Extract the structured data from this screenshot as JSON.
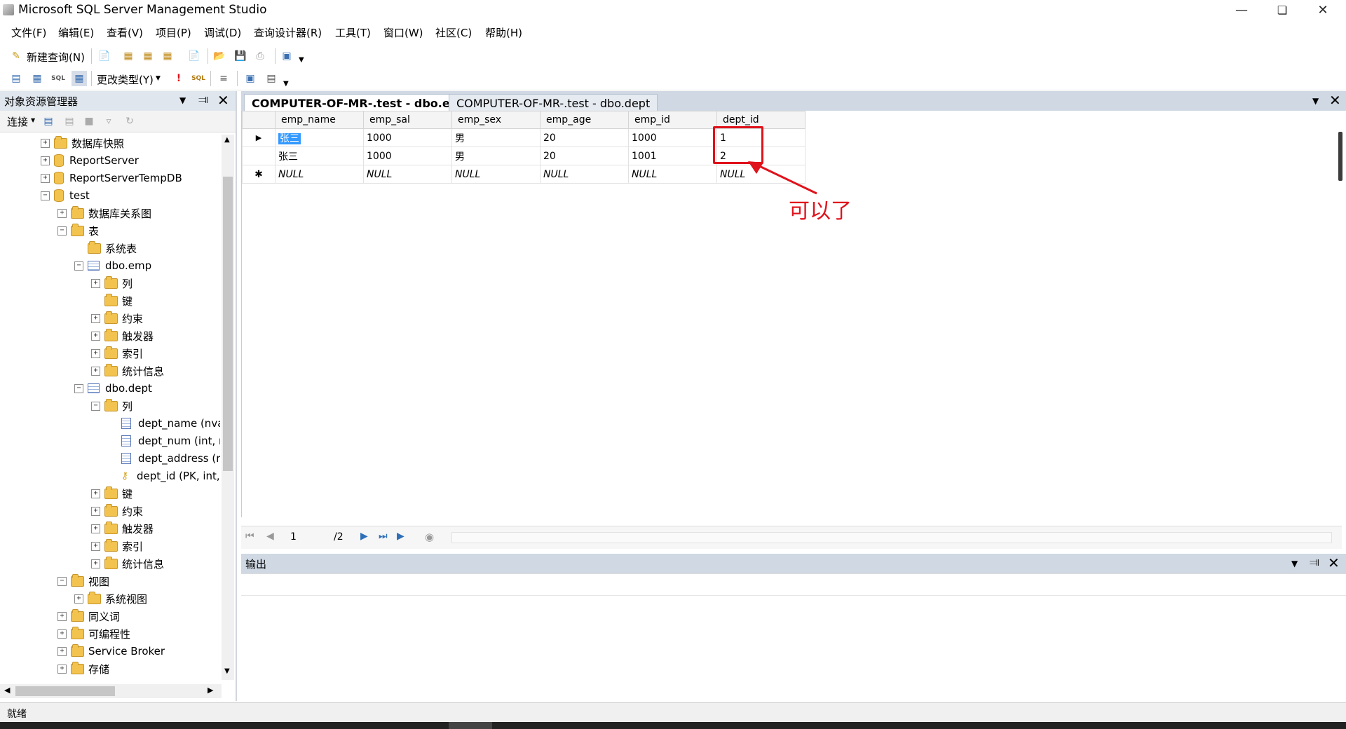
{
  "window": {
    "title": "Microsoft SQL Server Management Studio"
  },
  "menu": [
    "文件(F)",
    "编辑(E)",
    "查看(V)",
    "项目(P)",
    "调试(D)",
    "查询设计器(R)",
    "工具(T)",
    "窗口(W)",
    "社区(C)",
    "帮助(H)"
  ],
  "toolbar": {
    "new_query": "新建查询(N)",
    "change_type": "更改类型(Y)"
  },
  "object_explorer": {
    "title": "对象资源管理器",
    "connect": "连接",
    "tree": [
      {
        "label": "数据库快照",
        "level": 0,
        "expander": "+",
        "icon": "folder"
      },
      {
        "label": "ReportServer",
        "level": 0,
        "expander": "+",
        "icon": "db"
      },
      {
        "label": "ReportServerTempDB",
        "level": 0,
        "expander": "+",
        "icon": "db"
      },
      {
        "label": "test",
        "level": 0,
        "expander": "-",
        "icon": "db"
      },
      {
        "label": "数据库关系图",
        "level": 1,
        "expander": "+",
        "icon": "folder"
      },
      {
        "label": "表",
        "level": 1,
        "expander": "-",
        "icon": "folder"
      },
      {
        "label": "系统表",
        "level": 2,
        "expander": "",
        "icon": "folder"
      },
      {
        "label": "dbo.emp",
        "level": 2,
        "expander": "-",
        "icon": "table"
      },
      {
        "label": "列",
        "level": 3,
        "expander": "+",
        "icon": "folder"
      },
      {
        "label": "键",
        "level": 3,
        "expander": "",
        "icon": "folder"
      },
      {
        "label": "约束",
        "level": 3,
        "expander": "+",
        "icon": "folder"
      },
      {
        "label": "触发器",
        "level": 3,
        "expander": "+",
        "icon": "folder"
      },
      {
        "label": "索引",
        "level": 3,
        "expander": "+",
        "icon": "folder"
      },
      {
        "label": "统计信息",
        "level": 3,
        "expander": "+",
        "icon": "folder"
      },
      {
        "label": "dbo.dept",
        "level": 2,
        "expander": "-",
        "icon": "table"
      },
      {
        "label": "列",
        "level": 3,
        "expander": "-",
        "icon": "folder"
      },
      {
        "label": "dept_name (nva",
        "level": 4,
        "expander": "",
        "icon": "column"
      },
      {
        "label": "dept_num (int, n",
        "level": 4,
        "expander": "",
        "icon": "column"
      },
      {
        "label": "dept_address (r",
        "level": 4,
        "expander": "",
        "icon": "column"
      },
      {
        "label": "dept_id (PK, int,",
        "level": 4,
        "expander": "",
        "icon": "key"
      },
      {
        "label": "键",
        "level": 3,
        "expander": "+",
        "icon": "folder"
      },
      {
        "label": "约束",
        "level": 3,
        "expander": "+",
        "icon": "folder"
      },
      {
        "label": "触发器",
        "level": 3,
        "expander": "+",
        "icon": "folder"
      },
      {
        "label": "索引",
        "level": 3,
        "expander": "+",
        "icon": "folder"
      },
      {
        "label": "统计信息",
        "level": 3,
        "expander": "+",
        "icon": "folder"
      },
      {
        "label": "视图",
        "level": 1,
        "expander": "-",
        "icon": "folder"
      },
      {
        "label": "系统视图",
        "level": 2,
        "expander": "+",
        "icon": "folder"
      },
      {
        "label": "同义词",
        "level": 1,
        "expander": "+",
        "icon": "folder"
      },
      {
        "label": "可编程性",
        "level": 1,
        "expander": "+",
        "icon": "folder"
      },
      {
        "label": "Service Broker",
        "level": 1,
        "expander": "+",
        "icon": "folder"
      },
      {
        "label": "存储",
        "level": 1,
        "expander": "+",
        "icon": "folder"
      }
    ]
  },
  "tabs": [
    {
      "label": "COMPUTER-OF-MR-.test - dbo.emp",
      "active": true
    },
    {
      "label": "COMPUTER-OF-MR-.test - dbo.dept",
      "active": false
    }
  ],
  "grid": {
    "columns": [
      "emp_name",
      "emp_sal",
      "emp_sex",
      "emp_age",
      "emp_id",
      "dept_id"
    ],
    "rows": [
      [
        "张三",
        "1000",
        "男",
        "20",
        "1000",
        "1"
      ],
      [
        "张三",
        "1000",
        "男",
        "20",
        "1001",
        "2"
      ],
      [
        "NULL",
        "NULL",
        "NULL",
        "NULL",
        "NULL",
        "NULL"
      ]
    ],
    "row_markers": [
      "▶",
      "",
      "✱"
    ]
  },
  "annotation": {
    "text": "可以了",
    "color": "#e0121b"
  },
  "navigator": {
    "current_page": "1",
    "total": "/2"
  },
  "output": {
    "title": "输出"
  },
  "status": {
    "text": "就绪"
  }
}
